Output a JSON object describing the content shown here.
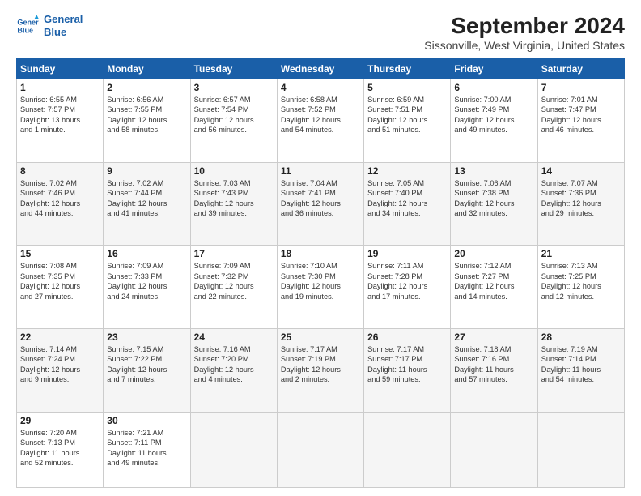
{
  "header": {
    "logo_line1": "General",
    "logo_line2": "Blue",
    "title": "September 2024",
    "subtitle": "Sissonville, West Virginia, United States"
  },
  "days_of_week": [
    "Sunday",
    "Monday",
    "Tuesday",
    "Wednesday",
    "Thursday",
    "Friday",
    "Saturday"
  ],
  "weeks": [
    [
      {
        "day": "1",
        "info": "Sunrise: 6:55 AM\nSunset: 7:57 PM\nDaylight: 13 hours\nand 1 minute."
      },
      {
        "day": "2",
        "info": "Sunrise: 6:56 AM\nSunset: 7:55 PM\nDaylight: 12 hours\nand 58 minutes."
      },
      {
        "day": "3",
        "info": "Sunrise: 6:57 AM\nSunset: 7:54 PM\nDaylight: 12 hours\nand 56 minutes."
      },
      {
        "day": "4",
        "info": "Sunrise: 6:58 AM\nSunset: 7:52 PM\nDaylight: 12 hours\nand 54 minutes."
      },
      {
        "day": "5",
        "info": "Sunrise: 6:59 AM\nSunset: 7:51 PM\nDaylight: 12 hours\nand 51 minutes."
      },
      {
        "day": "6",
        "info": "Sunrise: 7:00 AM\nSunset: 7:49 PM\nDaylight: 12 hours\nand 49 minutes."
      },
      {
        "day": "7",
        "info": "Sunrise: 7:01 AM\nSunset: 7:47 PM\nDaylight: 12 hours\nand 46 minutes."
      }
    ],
    [
      {
        "day": "8",
        "info": "Sunrise: 7:02 AM\nSunset: 7:46 PM\nDaylight: 12 hours\nand 44 minutes."
      },
      {
        "day": "9",
        "info": "Sunrise: 7:02 AM\nSunset: 7:44 PM\nDaylight: 12 hours\nand 41 minutes."
      },
      {
        "day": "10",
        "info": "Sunrise: 7:03 AM\nSunset: 7:43 PM\nDaylight: 12 hours\nand 39 minutes."
      },
      {
        "day": "11",
        "info": "Sunrise: 7:04 AM\nSunset: 7:41 PM\nDaylight: 12 hours\nand 36 minutes."
      },
      {
        "day": "12",
        "info": "Sunrise: 7:05 AM\nSunset: 7:40 PM\nDaylight: 12 hours\nand 34 minutes."
      },
      {
        "day": "13",
        "info": "Sunrise: 7:06 AM\nSunset: 7:38 PM\nDaylight: 12 hours\nand 32 minutes."
      },
      {
        "day": "14",
        "info": "Sunrise: 7:07 AM\nSunset: 7:36 PM\nDaylight: 12 hours\nand 29 minutes."
      }
    ],
    [
      {
        "day": "15",
        "info": "Sunrise: 7:08 AM\nSunset: 7:35 PM\nDaylight: 12 hours\nand 27 minutes."
      },
      {
        "day": "16",
        "info": "Sunrise: 7:09 AM\nSunset: 7:33 PM\nDaylight: 12 hours\nand 24 minutes."
      },
      {
        "day": "17",
        "info": "Sunrise: 7:09 AM\nSunset: 7:32 PM\nDaylight: 12 hours\nand 22 minutes."
      },
      {
        "day": "18",
        "info": "Sunrise: 7:10 AM\nSunset: 7:30 PM\nDaylight: 12 hours\nand 19 minutes."
      },
      {
        "day": "19",
        "info": "Sunrise: 7:11 AM\nSunset: 7:28 PM\nDaylight: 12 hours\nand 17 minutes."
      },
      {
        "day": "20",
        "info": "Sunrise: 7:12 AM\nSunset: 7:27 PM\nDaylight: 12 hours\nand 14 minutes."
      },
      {
        "day": "21",
        "info": "Sunrise: 7:13 AM\nSunset: 7:25 PM\nDaylight: 12 hours\nand 12 minutes."
      }
    ],
    [
      {
        "day": "22",
        "info": "Sunrise: 7:14 AM\nSunset: 7:24 PM\nDaylight: 12 hours\nand 9 minutes."
      },
      {
        "day": "23",
        "info": "Sunrise: 7:15 AM\nSunset: 7:22 PM\nDaylight: 12 hours\nand 7 minutes."
      },
      {
        "day": "24",
        "info": "Sunrise: 7:16 AM\nSunset: 7:20 PM\nDaylight: 12 hours\nand 4 minutes."
      },
      {
        "day": "25",
        "info": "Sunrise: 7:17 AM\nSunset: 7:19 PM\nDaylight: 12 hours\nand 2 minutes."
      },
      {
        "day": "26",
        "info": "Sunrise: 7:17 AM\nSunset: 7:17 PM\nDaylight: 11 hours\nand 59 minutes."
      },
      {
        "day": "27",
        "info": "Sunrise: 7:18 AM\nSunset: 7:16 PM\nDaylight: 11 hours\nand 57 minutes."
      },
      {
        "day": "28",
        "info": "Sunrise: 7:19 AM\nSunset: 7:14 PM\nDaylight: 11 hours\nand 54 minutes."
      }
    ],
    [
      {
        "day": "29",
        "info": "Sunrise: 7:20 AM\nSunset: 7:13 PM\nDaylight: 11 hours\nand 52 minutes."
      },
      {
        "day": "30",
        "info": "Sunrise: 7:21 AM\nSunset: 7:11 PM\nDaylight: 11 hours\nand 49 minutes."
      },
      {
        "day": "",
        "info": ""
      },
      {
        "day": "",
        "info": ""
      },
      {
        "day": "",
        "info": ""
      },
      {
        "day": "",
        "info": ""
      },
      {
        "day": "",
        "info": ""
      }
    ]
  ]
}
